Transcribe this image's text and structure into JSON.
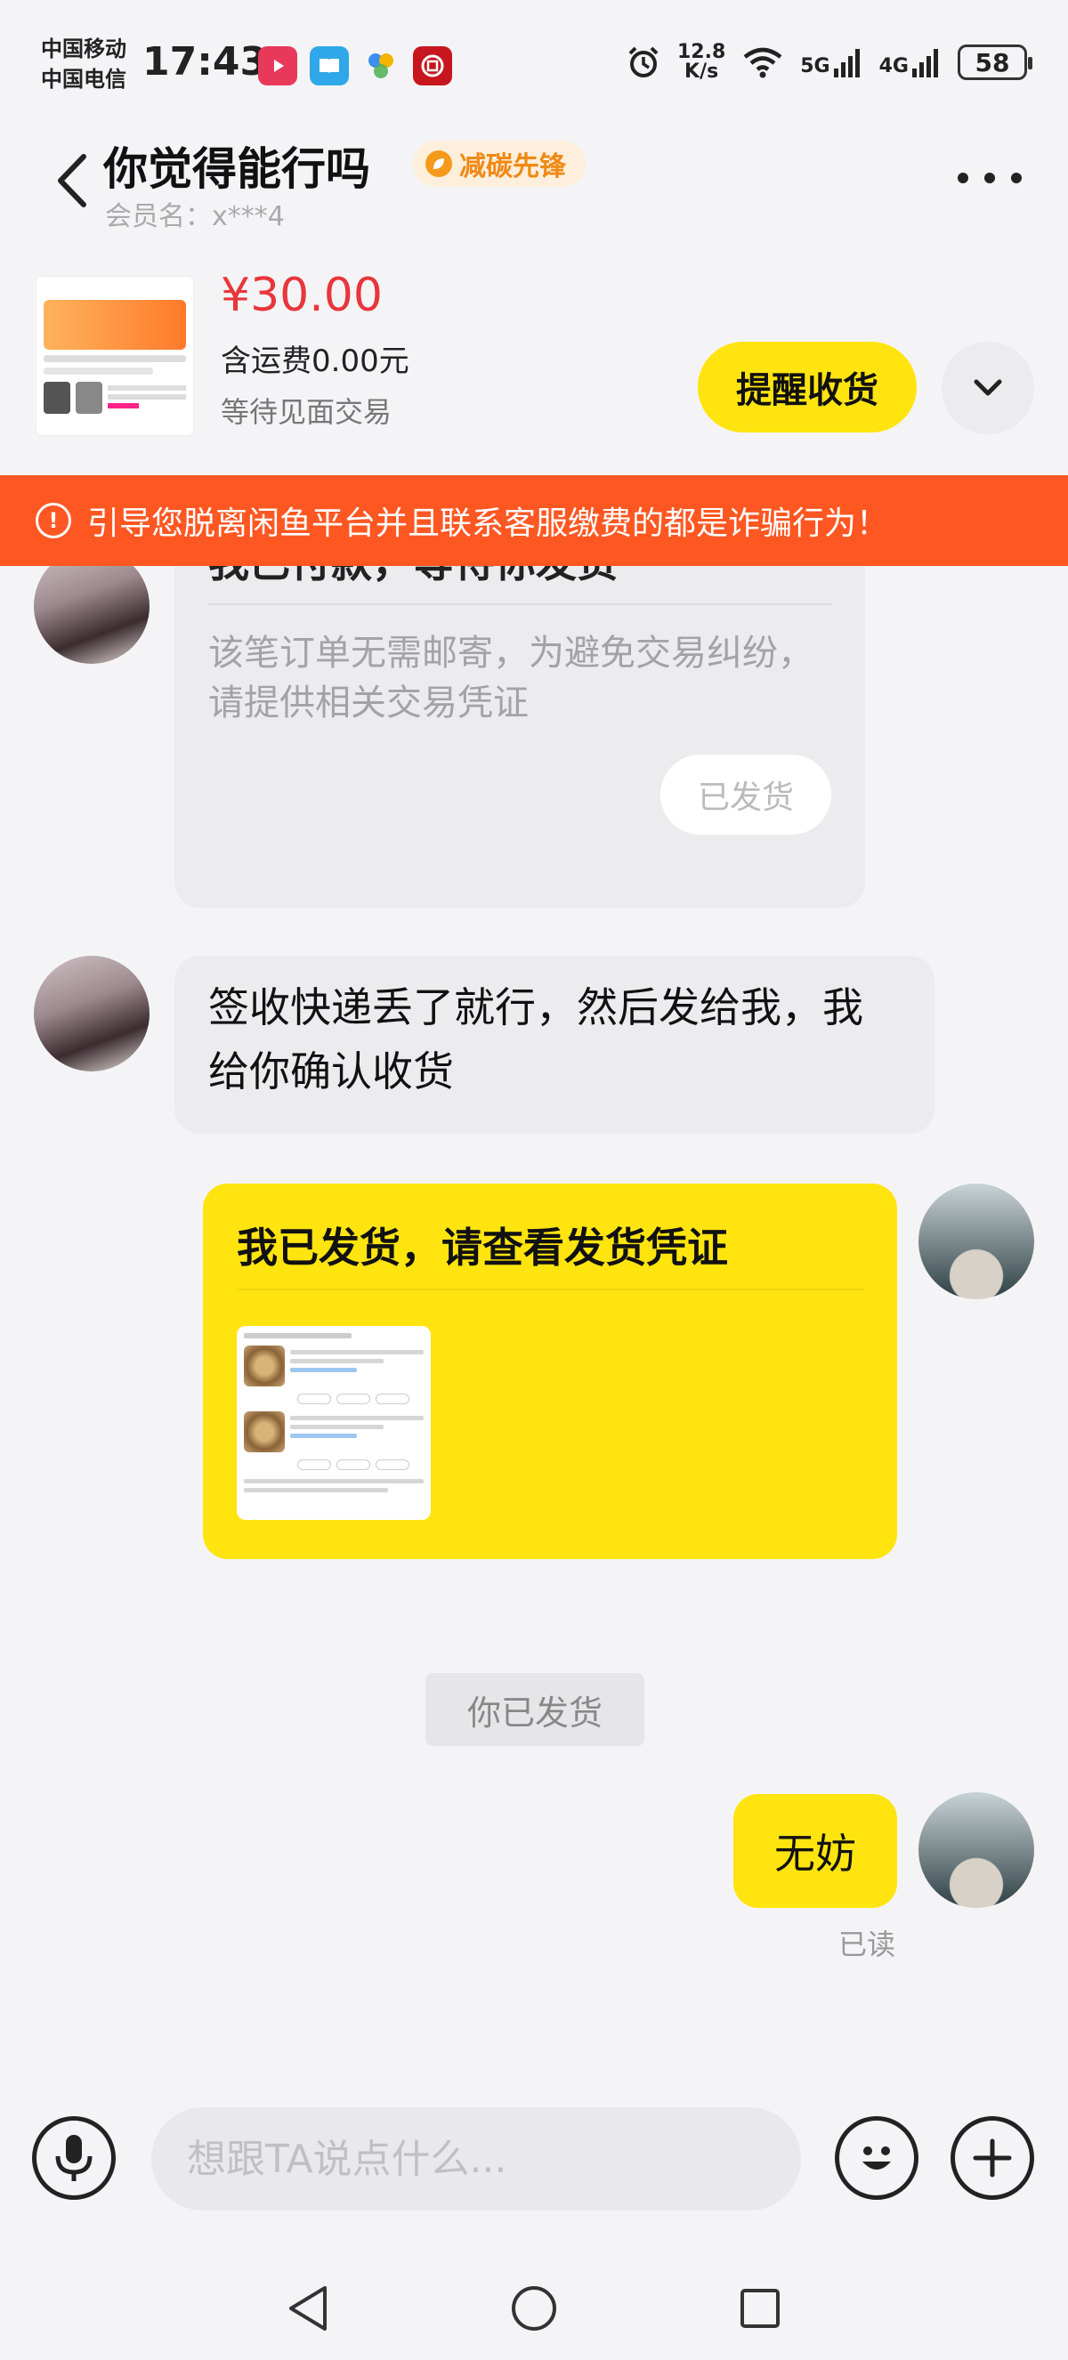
{
  "status_bar": {
    "carrier_1": "中国移动",
    "carrier_2": "中国电信",
    "time": "17:43",
    "net_speed_value": "12.8",
    "net_speed_unit": "K/s",
    "signal_5g": "5G",
    "signal_4g": "4G",
    "battery": "58"
  },
  "header": {
    "title": "你觉得能行吗",
    "badge": "减碳先锋",
    "member": "会员名：x***4"
  },
  "order": {
    "price": "¥30.00",
    "shipping": "含运费0.00元",
    "status": "等待见面交易",
    "remind_label": "提醒收货"
  },
  "warning": {
    "text": "引导您脱离闲鱼平台并且联系客服缴费的都是诈骗行为！"
  },
  "chat": {
    "card1": {
      "title": "我已付款，等待你发货",
      "desc": "该笔订单无需邮寄，为避免交易纠纷，请提供相关交易凭证",
      "button": "已发货"
    },
    "msg1": "签收快递丢了就行，然后发给我，我给你确认收货",
    "card2": {
      "title": "我已发货，请查看发货凭证"
    },
    "system_note": "你已发货",
    "msg2": "无妨",
    "read_status": "已读"
  },
  "input": {
    "placeholder": "想跟TA说点什么..."
  },
  "colors": {
    "accent_yellow": "#ffe40f",
    "price_red": "#e8363c",
    "warning_orange": "#ff5722",
    "badge_orange": "#f08a16"
  }
}
